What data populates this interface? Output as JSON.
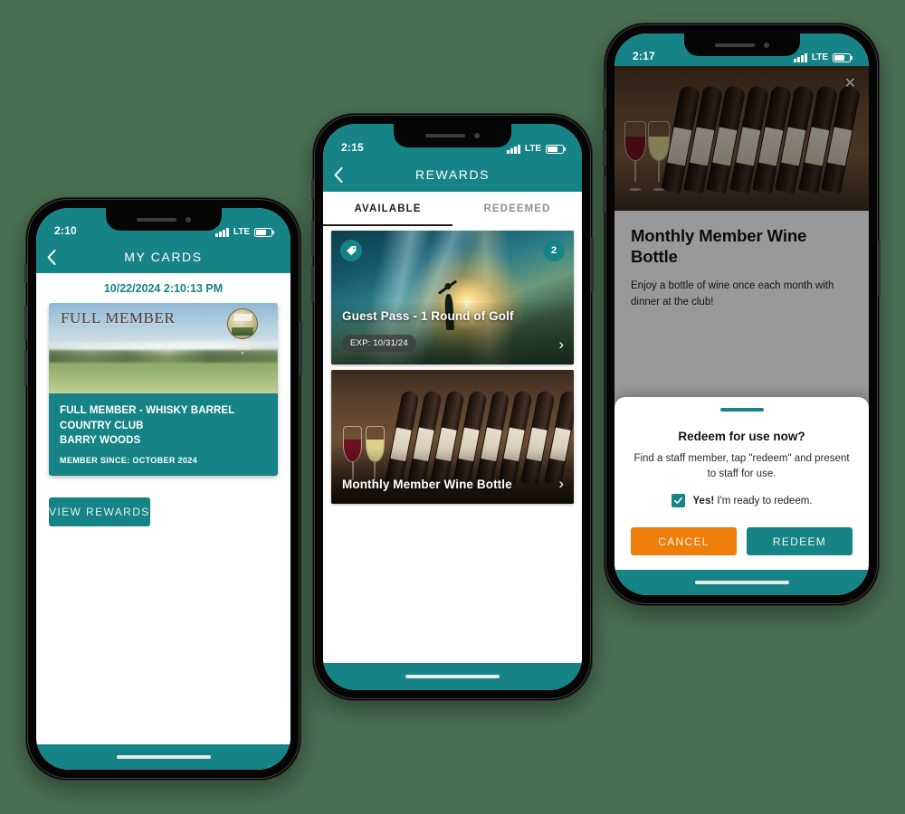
{
  "theme": {
    "page_background": "#4a7052",
    "teal": "#168486",
    "orange": "#ef7d0a"
  },
  "phone1": {
    "name": "my-cards-screen",
    "status_bar": {
      "time": "2:10",
      "network": "LTE"
    },
    "nav": {
      "back_icon": "chevron-left-icon",
      "title": "MY CARDS"
    },
    "timestamp": "10/22/2024 2:10:13 PM",
    "card": {
      "image_title": "FULL MEMBER",
      "logo_text": "COUNTRY CLUB",
      "logo_sub": "✦",
      "line1": "FULL MEMBER - WHISKY BARREL",
      "line2": "COUNTRY CLUB",
      "line3": "BARRY WOODS",
      "member_since": "MEMBER SINCE: OCTOBER 2024"
    },
    "view_rewards_label": "VIEW REWARDS"
  },
  "phone2": {
    "name": "rewards-list-screen",
    "status_bar": {
      "time": "2:15",
      "network": "LTE"
    },
    "nav": {
      "back_icon": "chevron-left-icon",
      "title": "REWARDS"
    },
    "tabs": [
      {
        "label": "AVAILABLE",
        "active": true
      },
      {
        "label": "REDEEMED",
        "active": false
      }
    ],
    "rewards": [
      {
        "title": "Guest Pass - 1 Round of Golf",
        "expiry": "EXP: 10/31/24",
        "count_badge": "2",
        "tag_icon": "tag-icon",
        "chevron": "›"
      },
      {
        "title": "Monthly Member Wine Bottle",
        "expiry": "",
        "count_badge": "",
        "chevron": "›"
      }
    ]
  },
  "phone3": {
    "name": "reward-detail-redeem-screen",
    "status_bar": {
      "time": "2:17",
      "network": "LTE"
    },
    "close_icon": "close-icon",
    "detail": {
      "title": "Monthly Member Wine Bottle",
      "description": "Enjoy a bottle of wine once each month with dinner at the club!"
    },
    "sheet": {
      "title": "Redeem for use now?",
      "description": "Find a staff member, tap \"redeem\" and present to staff for use.",
      "checkbox_checked": true,
      "checkbox_strong": "Yes!",
      "checkbox_rest": " I'm ready to redeem.",
      "cancel_label": "CANCEL",
      "redeem_label": "REDEEM"
    }
  }
}
